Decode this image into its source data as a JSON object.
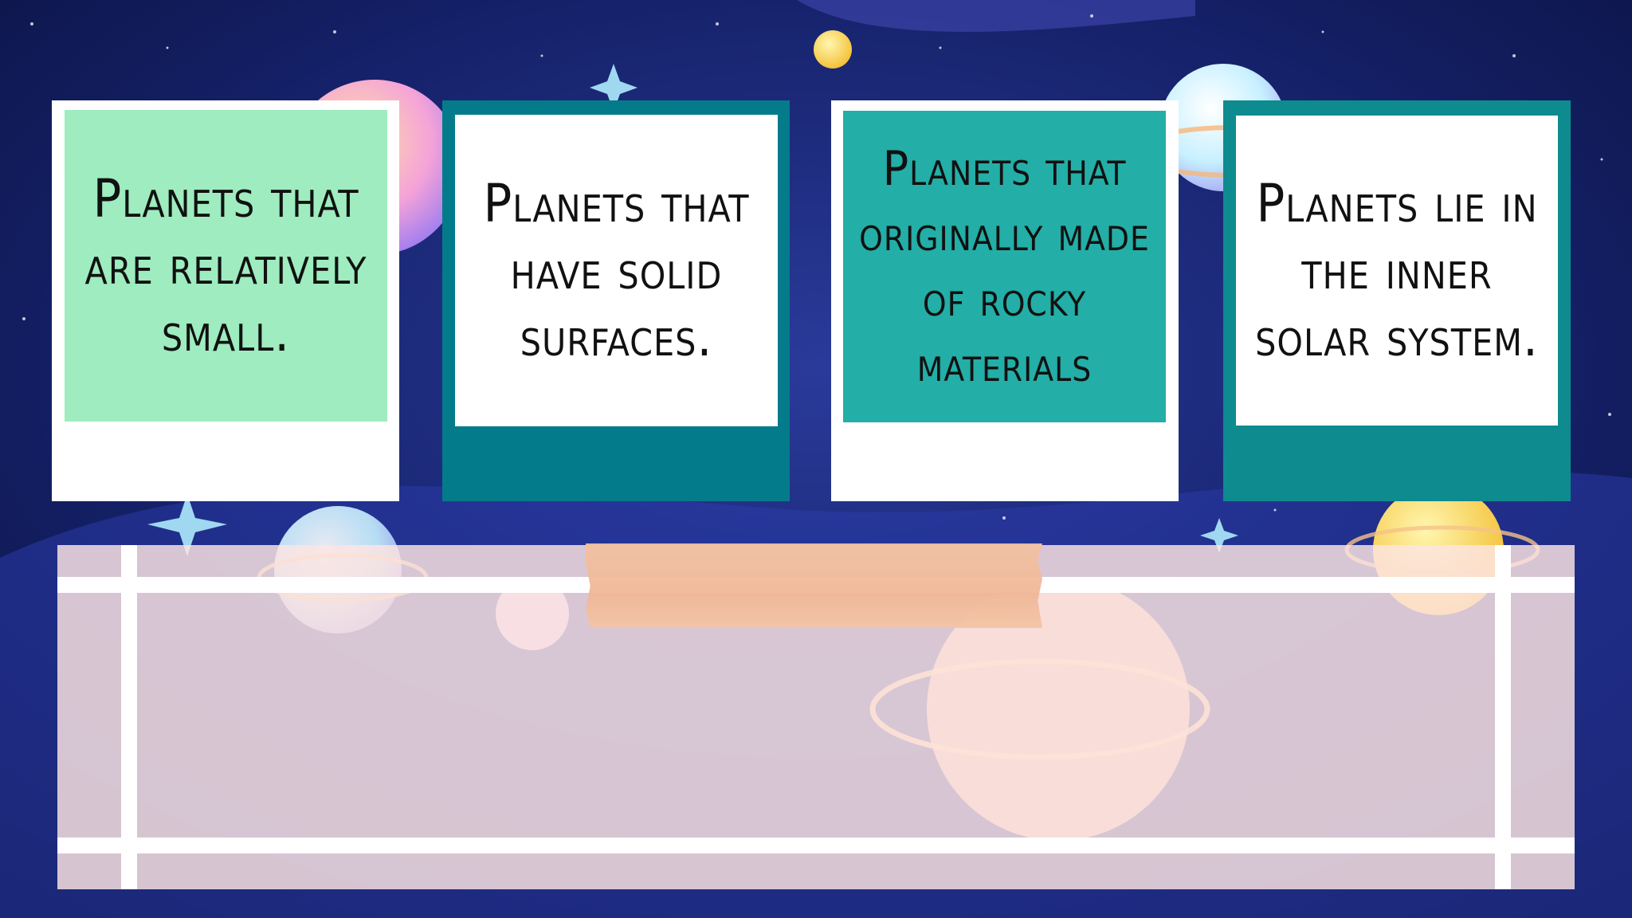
{
  "cards": [
    {
      "text": "Planets that are relatively small."
    },
    {
      "text": "Planets that have solid surfaces."
    },
    {
      "text": "Planets that originally made of rocky materials"
    },
    {
      "text": "Planets lie in the inner solar system."
    }
  ],
  "colors": {
    "space_dark": "#0f1a4a",
    "card_green": "#9eecbf",
    "card_teal": "#047b8a",
    "card_aqua": "#23aea7",
    "card_sea": "#0e8b8e",
    "tape": "#f0b797"
  }
}
